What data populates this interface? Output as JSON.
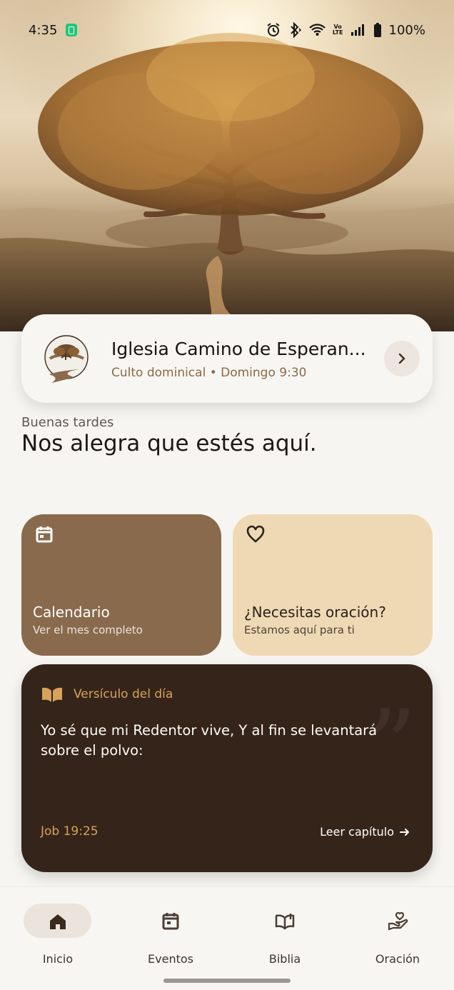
{
  "status": {
    "time": "4:35",
    "battery": "100%"
  },
  "church": {
    "name": "Iglesia Camino de Esperan...",
    "subtitle": "Culto dominical • Domingo 9:30"
  },
  "greeting": {
    "small": "Buenas tardes",
    "title": "Nos alegra que estés aquí."
  },
  "cards": {
    "calendar": {
      "title": "Calendario",
      "subtitle": "Ver el mes completo",
      "icon": "calendar-icon"
    },
    "prayer": {
      "title": "¿Necesitas oración?",
      "subtitle": "Estamos aquí para ti",
      "icon": "heart-icon"
    }
  },
  "verse": {
    "label": "Versículo del día",
    "text": "Yo sé que mi Redentor vive, Y al fin se levantará sobre el polvo:",
    "reference": "Job 19:25",
    "action": "Leer capítulo"
  },
  "nav": {
    "items": [
      {
        "label": "Inicio",
        "icon": "home-icon",
        "active": true
      },
      {
        "label": "Eventos",
        "icon": "calendar-icon",
        "active": false
      },
      {
        "label": "Biblia",
        "icon": "book-icon",
        "active": false
      },
      {
        "label": "Oración",
        "icon": "prayer-icon",
        "active": false
      }
    ]
  },
  "colors": {
    "accent_brown": "#8a6a4c",
    "soft_tan": "#efd9b5",
    "dark_card": "#35241a",
    "gold": "#d7a259",
    "background": "#f7f5f1"
  }
}
